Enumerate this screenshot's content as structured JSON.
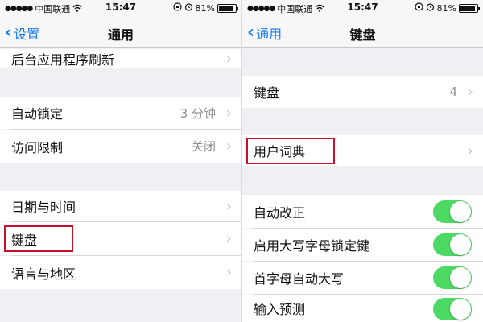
{
  "left": {
    "status": {
      "carrier": "中国联通",
      "time": "15:47",
      "battery": "81%",
      "battery_level": 0.81
    },
    "nav": {
      "back_label": "设置",
      "title": "通用"
    },
    "rows": {
      "background_refresh": "后台应用程序刷新",
      "auto_lock": "自动锁定",
      "auto_lock_value": "3 分钟",
      "restrictions": "访问限制",
      "restrictions_value": "关闭",
      "date_time": "日期与时间",
      "keyboard": "键盘",
      "language_region": "语言与地区"
    }
  },
  "right": {
    "status": {
      "carrier": "中国联通",
      "time": "15:47",
      "battery": "81%",
      "battery_level": 0.81
    },
    "nav": {
      "back_label": "通用",
      "title": "键盘"
    },
    "rows": {
      "keyboards": "键盘",
      "keyboards_count": "4",
      "user_dictionary": "用户词典",
      "auto_correction": "自动改正",
      "caps_lock": "启用大写字母锁定键",
      "auto_capitalization": "首字母自动大写",
      "predictive": "输入预测"
    },
    "toggles": {
      "auto_correction": true,
      "caps_lock": true,
      "auto_capitalization": true,
      "predictive": true
    }
  },
  "colors": {
    "accent": "#1a7cf5",
    "toggle_on": "#4cd964",
    "highlight_box": "#c8102e",
    "group_background": "#efeff4"
  },
  "icons": {
    "signal": "signal-dots-icon",
    "wifi": "wifi-icon",
    "orientation_lock": "orientation-lock-icon",
    "alarm": "alarm-icon",
    "battery": "battery-icon",
    "back": "chevron-left-icon",
    "disclosure": "chevron-right-icon"
  }
}
